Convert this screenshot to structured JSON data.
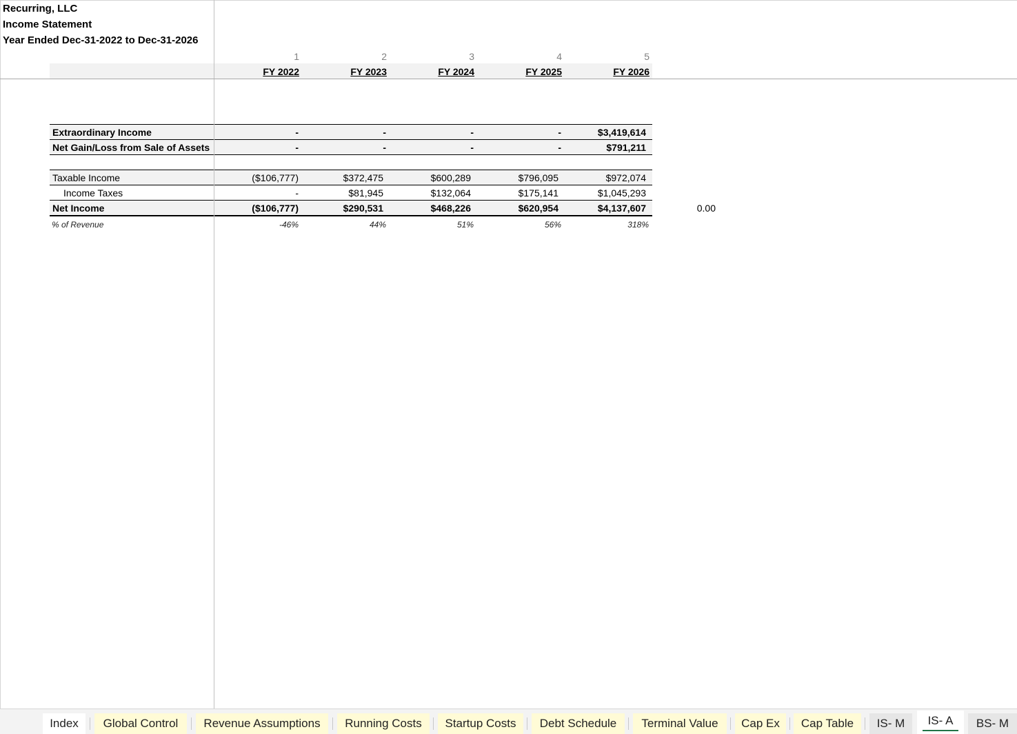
{
  "header": {
    "company": "Recurring, LLC",
    "statement": "Income Statement",
    "period": "Year Ended Dec-31-2022 to Dec-31-2026"
  },
  "columns": {
    "numbers": [
      "1",
      "2",
      "3",
      "4",
      "5"
    ],
    "years": [
      "FY 2022",
      "FY 2023",
      "FY 2024",
      "FY 2025",
      "FY 2026"
    ]
  },
  "rows": {
    "extraordinary": {
      "label": "Extraordinary Income",
      "values": [
        "-",
        "-",
        "-",
        "-",
        "$3,419,614"
      ]
    },
    "net_gain": {
      "label": "Net Gain/Loss from Sale of Assets",
      "values": [
        "-",
        "-",
        "-",
        "-",
        "$791,211"
      ]
    },
    "taxable": {
      "label": "Taxable Income",
      "values": [
        "($106,777)",
        "$372,475",
        "$600,289",
        "$796,095",
        "$972,074"
      ]
    },
    "taxes": {
      "label": "Income Taxes",
      "values": [
        "-",
        "$81,945",
        "$132,064",
        "$175,141",
        "$1,045,293"
      ]
    },
    "net_income": {
      "label": "Net Income",
      "values": [
        "($106,777)",
        "$290,531",
        "$468,226",
        "$620,954",
        "$4,137,607"
      ]
    },
    "pct_revenue": {
      "label": "% of Revenue",
      "values": [
        "-46%",
        "44%",
        "51%",
        "56%",
        "318%"
      ]
    }
  },
  "check_value": "0.00",
  "tabs": [
    {
      "label": "Index"
    },
    {
      "label": "Global Control"
    },
    {
      "label": "Revenue Assumptions"
    },
    {
      "label": "Running Costs"
    },
    {
      "label": "Startup Costs"
    },
    {
      "label": "Debt Schedule"
    },
    {
      "label": "Terminal Value"
    },
    {
      "label": "Cap Ex"
    },
    {
      "label": "Cap Table"
    },
    {
      "label": "IS- M"
    },
    {
      "label": "IS- A"
    },
    {
      "label": "BS- M"
    }
  ],
  "active_tab": "IS- A",
  "colors": {
    "tab_yellow": "#fffbd6",
    "active_underline": "#217346",
    "row_shade": "#f2f2f2"
  }
}
